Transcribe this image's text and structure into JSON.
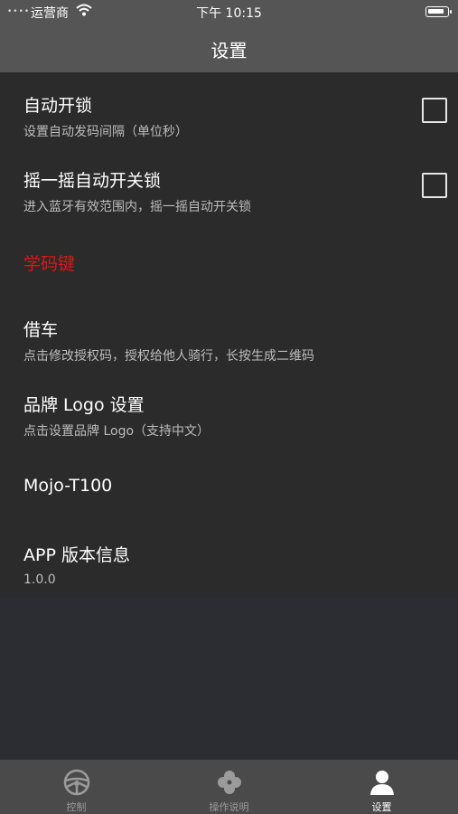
{
  "status_bar": {
    "signal": "••••",
    "carrier": "运营商",
    "time": "下午 10:15"
  },
  "nav": {
    "title": "设置"
  },
  "settings": {
    "auto_unlock": {
      "title": "自动开锁",
      "subtitle": "设置自动发码间隔（单位秒）",
      "checked": false
    },
    "shake_unlock": {
      "title": "摇一摇自动开关锁",
      "subtitle": "进入蓝牙有效范围内，摇一摇自动开关锁",
      "checked": false
    },
    "learn_code": {
      "title": "学码键",
      "color": "#e01515"
    },
    "borrow": {
      "title": "借车",
      "subtitle": "点击修改授权码，授权给他人骑行，长按生成二维码"
    },
    "brand_logo": {
      "title": "品牌 Logo 设置",
      "subtitle": "点击设置品牌 Logo（支持中文）"
    },
    "device": {
      "title": "Mojo-T100"
    },
    "app_version": {
      "title": "APP 版本信息",
      "subtitle": "1.0.0"
    }
  },
  "tabbar": {
    "tabs": [
      {
        "label": "控制",
        "icon": "steering-wheel-icon",
        "active": false
      },
      {
        "label": "操作说明",
        "icon": "clover-icon",
        "active": false
      },
      {
        "label": "设置",
        "icon": "user-icon",
        "active": true
      }
    ]
  }
}
